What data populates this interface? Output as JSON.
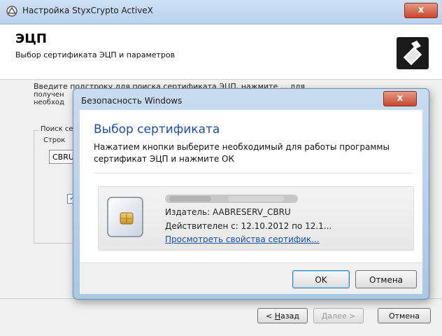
{
  "outer_window": {
    "title": "Настройка StyxCrypto ActiveX",
    "close_glyph": "x",
    "header_title": "ЭЦП",
    "header_subtitle": "Выбор сертификата ЭЦП и параметров",
    "instructions_line1": "Введите подстроку для поиска сертификата ЭЦП, нажмите ... для",
    "instructions_line2": "получен",
    "instructions_line3": "необход",
    "search_group_label": "Поиск се",
    "string_label": "Строк",
    "search_value": "CBRU",
    "checkbox_glyph": "✓",
    "buttons": {
      "back_prefix": "< ",
      "back_hotkey": "Н",
      "back_rest": "азад",
      "next_hotkey": "Д",
      "next_rest": "алее >",
      "cancel": "Отмена"
    }
  },
  "dialog": {
    "title": "Безопасность Windows",
    "close_glyph": "x",
    "heading": "Выбор сертификата",
    "description_line1": "Нажатием кнопки выберите необходимый для работы программы",
    "description_line2": "сертификат ЭЦП и нажмите ОК",
    "certificate": {
      "issuer": "Издатель: AABRESERV_CBRU",
      "validity": "Действителен с: 12.10.2012 по 12.1...",
      "details_link": "Просмотреть свойства сертифик..."
    },
    "ok_label": "OK",
    "cancel_label": "Отмена"
  },
  "icons": {
    "app": "styxcrypto-app-icon",
    "header": "printer-key-icon",
    "certificate": "smart-card-icon"
  },
  "colors": {
    "accent_blue": "#1b4fa0",
    "close_red": "#c9472c",
    "titlebar": "#b9d1ec"
  }
}
